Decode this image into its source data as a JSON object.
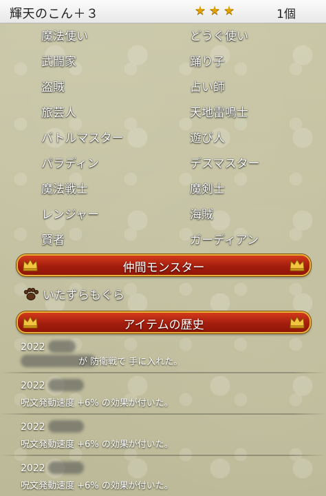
{
  "header": {
    "title": "輝天のこん＋３",
    "stars": 3,
    "count": "1個"
  },
  "jobs": [
    [
      "魔法使い",
      "どうぐ使い"
    ],
    [
      "武闘家",
      "踊り子"
    ],
    [
      "盗賊",
      "占い師"
    ],
    [
      "旅芸人",
      "天地雷鳴士"
    ],
    [
      "バトルマスター",
      "遊び人"
    ],
    [
      "パラディン",
      "デスマスター"
    ],
    [
      "魔法戦士",
      "魔剣士"
    ],
    [
      "レンジャー",
      "海賊"
    ],
    [
      "賢者",
      "ガーディアン"
    ]
  ],
  "sections": {
    "monster_title": "仲間モンスター",
    "history_title": "アイテムの歴史"
  },
  "monster": {
    "name": "いたずらもぐら",
    "icon": "paw-icon"
  },
  "history": [
    {
      "date": "2022",
      "text": "が 防衛戦で 手に入れた。"
    },
    {
      "date": "2022",
      "text": "呪文発動速度 +6% の効果が付いた。"
    },
    {
      "date": "2022",
      "text": "呪文発動速度 +6% の効果が付いた。"
    },
    {
      "date": "2022",
      "text": "呪文発動速度 +6% の効果が付いた。"
    }
  ],
  "colors": {
    "banner": "#b8250f",
    "banner_border": "#e8b23b",
    "star": "#e0a000",
    "background": "#c5c3a3"
  }
}
